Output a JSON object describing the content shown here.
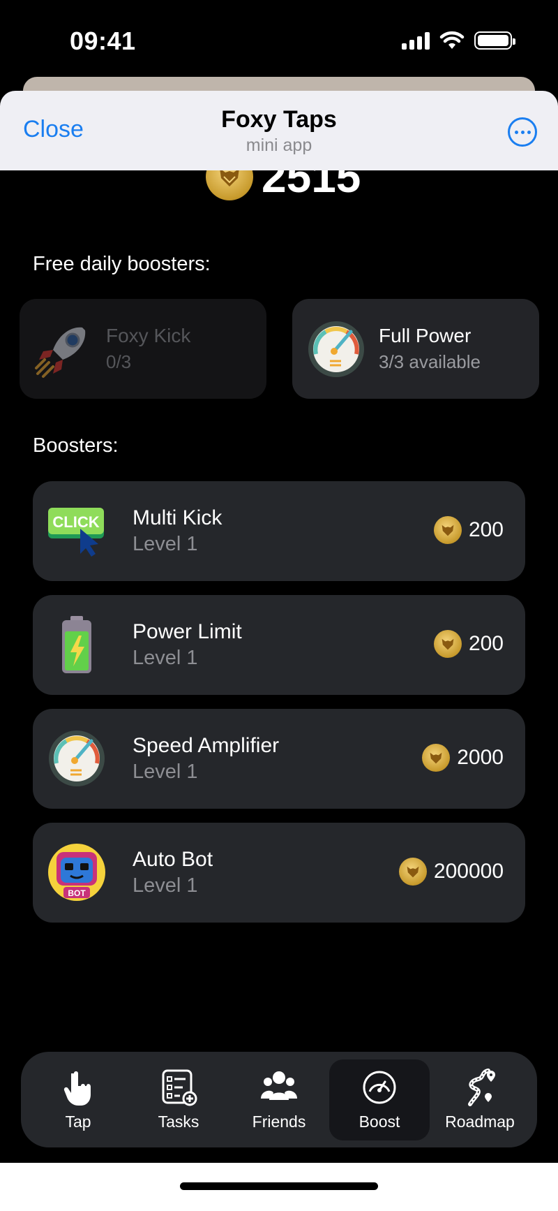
{
  "status_bar": {
    "time": "09:41"
  },
  "header": {
    "close_label": "Close",
    "title": "Foxy Taps",
    "subtitle": "mini app"
  },
  "balance": {
    "value": "2515"
  },
  "daily": {
    "title": "Free daily boosters:",
    "items": [
      {
        "name": "Foxy Kick",
        "status": "0/3",
        "icon": "rocket-icon",
        "disabled": true
      },
      {
        "name": "Full Power",
        "status": "3/3 available",
        "icon": "speedometer-icon",
        "disabled": false
      }
    ]
  },
  "boosters": {
    "title": "Boosters:",
    "items": [
      {
        "name": "Multi Kick",
        "level": "Level 1",
        "price": "200",
        "icon": "click-icon"
      },
      {
        "name": "Power Limit",
        "level": "Level 1",
        "price": "200",
        "icon": "battery-icon"
      },
      {
        "name": "Speed Amplifier",
        "level": "Level 1",
        "price": "2000",
        "icon": "speedometer-icon"
      },
      {
        "name": "Auto Bot",
        "level": "Level 1",
        "price": "200000",
        "icon": "robot-icon"
      }
    ]
  },
  "nav": {
    "active": "Boost",
    "items": [
      {
        "label": "Tap",
        "icon": "tap-hand-icon"
      },
      {
        "label": "Tasks",
        "icon": "checklist-icon"
      },
      {
        "label": "Friends",
        "icon": "friends-icon"
      },
      {
        "label": "Boost",
        "icon": "gauge-icon"
      },
      {
        "label": "Roadmap",
        "icon": "roadmap-icon"
      }
    ]
  },
  "colors": {
    "accent_blue": "#1a7ef0",
    "card_bg": "#25272b",
    "coin_gold": "#c79a2c"
  }
}
